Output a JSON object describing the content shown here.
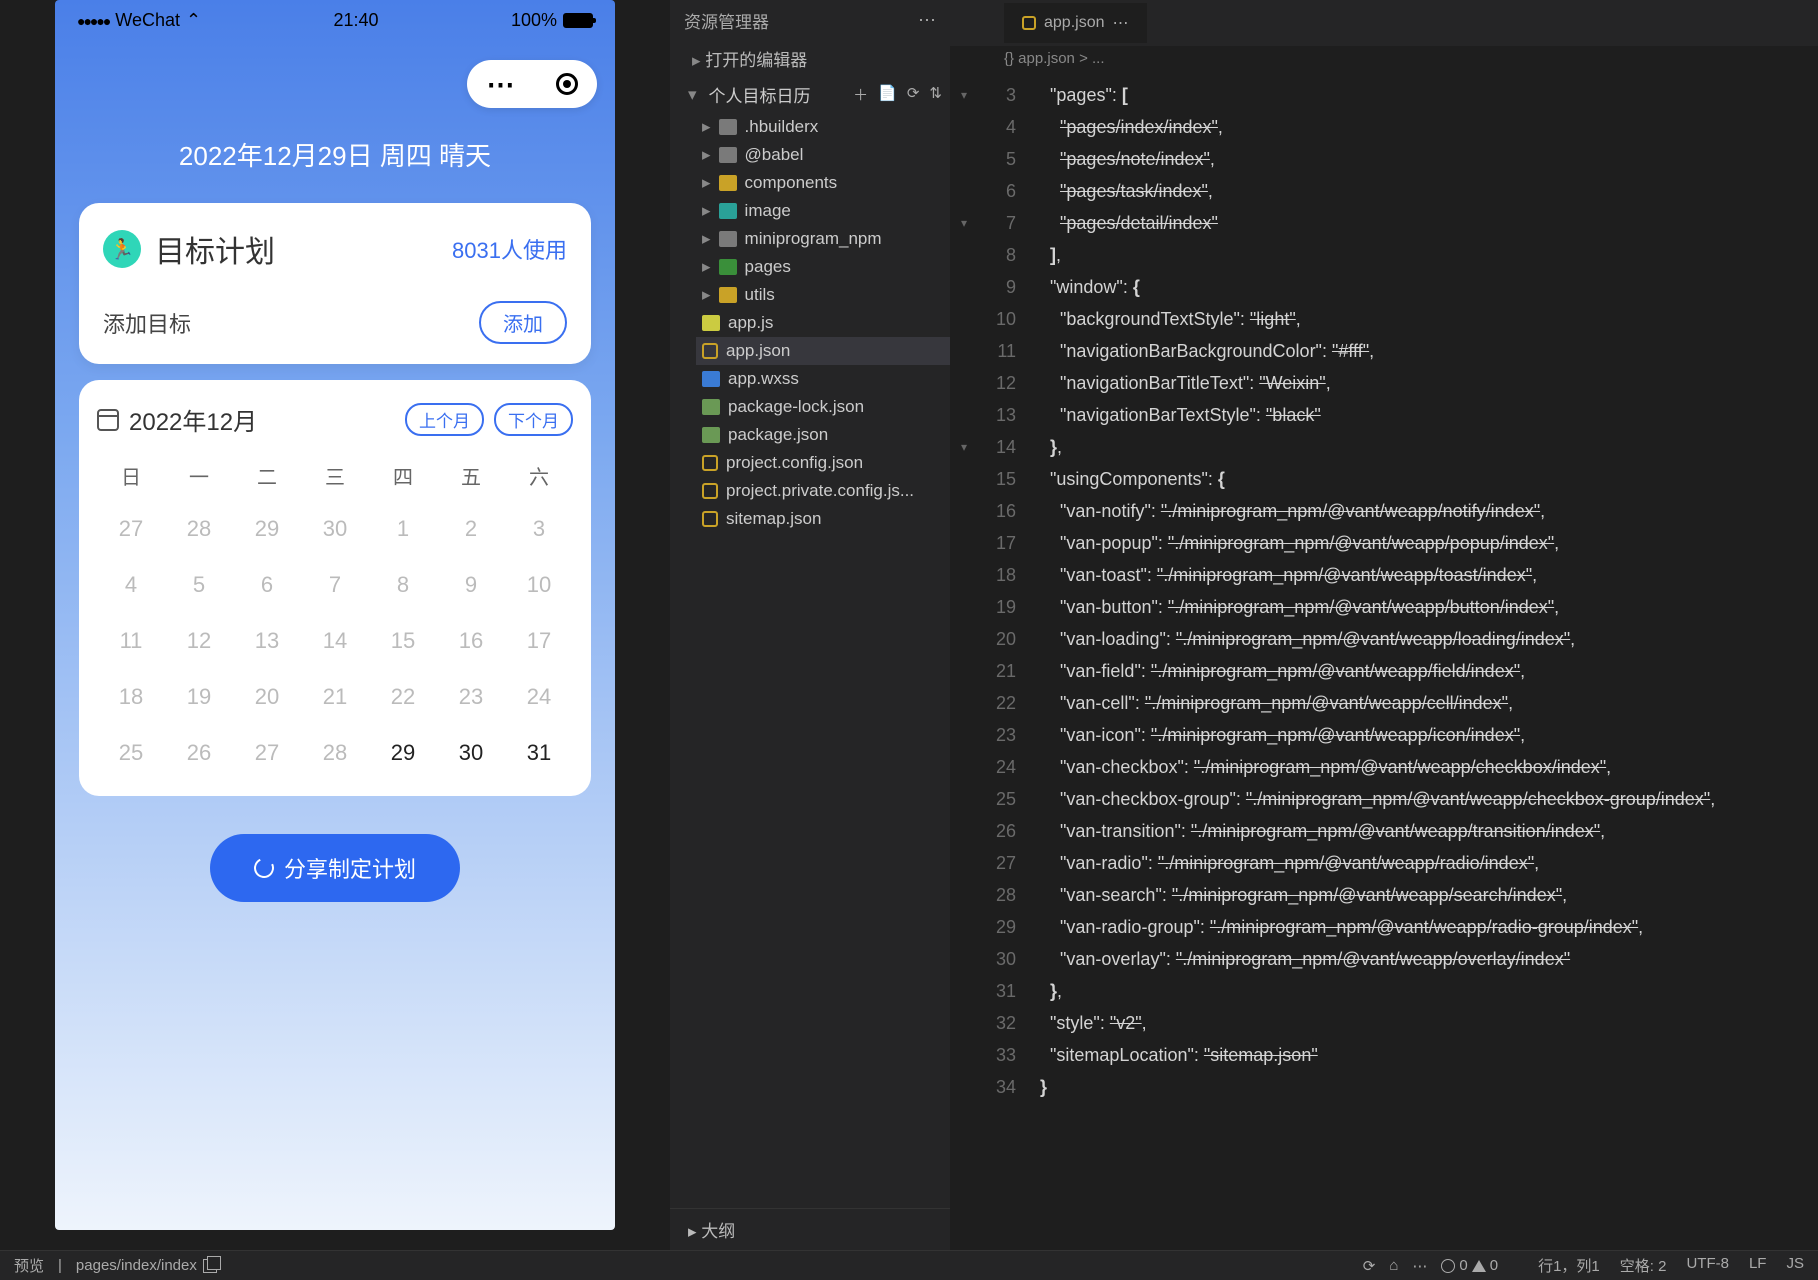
{
  "phone": {
    "statusbar": {
      "carrier": "WeChat",
      "signal": "●●●●●",
      "wifi": "⌃",
      "time": "21:40",
      "battery": "100%"
    },
    "dateHeader": "2022年12月29日 周四 晴天",
    "card": {
      "icon": "🏃",
      "title": "目标计划",
      "usage": "8031人使用",
      "addLabel": "添加目标",
      "addBtn": "添加"
    },
    "calendar": {
      "month": "2022年12月",
      "prevBtn": "上个月",
      "nextBtn": "下个月",
      "weekdays": [
        "日",
        "一",
        "二",
        "三",
        "四",
        "五",
        "六"
      ],
      "days": [
        {
          "n": "27"
        },
        {
          "n": "28"
        },
        {
          "n": "29"
        },
        {
          "n": "30"
        },
        {
          "n": "1"
        },
        {
          "n": "2"
        },
        {
          "n": "3"
        },
        {
          "n": "4"
        },
        {
          "n": "5"
        },
        {
          "n": "6"
        },
        {
          "n": "7"
        },
        {
          "n": "8"
        },
        {
          "n": "9"
        },
        {
          "n": "10"
        },
        {
          "n": "11"
        },
        {
          "n": "12"
        },
        {
          "n": "13"
        },
        {
          "n": "14"
        },
        {
          "n": "15"
        },
        {
          "n": "16"
        },
        {
          "n": "17"
        },
        {
          "n": "18"
        },
        {
          "n": "19"
        },
        {
          "n": "20"
        },
        {
          "n": "21"
        },
        {
          "n": "22"
        },
        {
          "n": "23"
        },
        {
          "n": "24"
        },
        {
          "n": "25"
        },
        {
          "n": "26"
        },
        {
          "n": "27"
        },
        {
          "n": "28"
        },
        {
          "n": "29",
          "cur": true
        },
        {
          "n": "30",
          "cur": true
        },
        {
          "n": "31",
          "cur": true
        }
      ]
    },
    "shareBtn": "分享制定计划"
  },
  "explorer": {
    "title": "资源管理器",
    "openEditors": "打开的编辑器",
    "rootName": "个人目标日历",
    "rootActions": [
      "＋",
      "📄",
      "⟳",
      "⇅"
    ],
    "items": [
      {
        "type": "folder",
        "icon": "fi-folder",
        "name": ".hbuilderx"
      },
      {
        "type": "folder",
        "icon": "fi-folder",
        "name": "@babel"
      },
      {
        "type": "folder",
        "icon": "fi-folder-y",
        "name": "components"
      },
      {
        "type": "folder",
        "icon": "fi-img",
        "name": "image"
      },
      {
        "type": "folder",
        "icon": "fi-folder",
        "name": "miniprogram_npm"
      },
      {
        "type": "folder",
        "icon": "fi-folder-g",
        "name": "pages"
      },
      {
        "type": "folder",
        "icon": "fi-folder-y",
        "name": "utils"
      },
      {
        "type": "file",
        "icon": "fi-js",
        "name": "app.js"
      },
      {
        "type": "file",
        "icon": "fi-json",
        "name": "app.json",
        "sel": true
      },
      {
        "type": "file",
        "icon": "fi-wxss",
        "name": "app.wxss"
      },
      {
        "type": "file",
        "icon": "fi-cfg",
        "name": "package-lock.json"
      },
      {
        "type": "file",
        "icon": "fi-cfg",
        "name": "package.json"
      },
      {
        "type": "file",
        "icon": "fi-json",
        "name": "project.config.json"
      },
      {
        "type": "file",
        "icon": "fi-json",
        "name": "project.private.config.js..."
      },
      {
        "type": "file",
        "icon": "fi-json",
        "name": "sitemap.json"
      }
    ],
    "outline": "大纲"
  },
  "editor": {
    "tab": "app.json",
    "breadcrumb": "{} app.json > ...",
    "startLine": 3,
    "foldMarks": {
      "3": "▾",
      "7": "▾",
      "14": "▾"
    },
    "lines": [
      {
        "t": "  <k>\"pages\"</k>: <b>[</b>"
      },
      {
        "t": "    <s>\"pages/index/index\"</s>,"
      },
      {
        "t": "    <s>\"pages/note/index\"</s>,"
      },
      {
        "t": "    <s>\"pages/task/index\"</s>,"
      },
      {
        "t": "    <s>\"pages/detail/index\"</s>"
      },
      {
        "t": "  <b>]</b>,"
      },
      {
        "t": "  <k>\"window\"</k>: <b>{</b>"
      },
      {
        "t": "    <k>\"backgroundTextStyle\"</k>: <s>\"light\"</s>,"
      },
      {
        "t": "    <k>\"navigationBarBackgroundColor\"</k>: <s>\"#fff\"</s>,"
      },
      {
        "t": "    <k>\"navigationBarTitleText\"</k>: <s>\"Weixin\"</s>,"
      },
      {
        "t": "    <k>\"navigationBarTextStyle\"</k>: <s>\"black\"</s>"
      },
      {
        "t": "  <b>}</b>,"
      },
      {
        "t": "  <k>\"usingComponents\"</k>: <b>{</b>"
      },
      {
        "t": "    <k>\"van-notify\"</k>: <s>\"./miniprogram_npm/@vant/weapp/notify/index\"</s>,"
      },
      {
        "t": "    <k>\"van-popup\"</k>: <s>\"./miniprogram_npm/@vant/weapp/popup/index\"</s>,"
      },
      {
        "t": "    <k>\"van-toast\"</k>: <s>\"./miniprogram_npm/@vant/weapp/toast/index\"</s>,"
      },
      {
        "t": "    <k>\"van-button\"</k>: <s>\"./miniprogram_npm/@vant/weapp/button/index\"</s>,"
      },
      {
        "t": "    <k>\"van-loading\"</k>: <s>\"./miniprogram_npm/@vant/weapp/loading/index\"</s>,"
      },
      {
        "t": "    <k>\"van-field\"</k>: <s>\"./miniprogram_npm/@vant/weapp/field/index\"</s>,"
      },
      {
        "t": "    <k>\"van-cell\"</k>: <s>\"./miniprogram_npm/@vant/weapp/cell/index\"</s>,"
      },
      {
        "t": "    <k>\"van-icon\"</k>: <s>\"./miniprogram_npm/@vant/weapp/icon/index\"</s>,"
      },
      {
        "t": "    <k>\"van-checkbox\"</k>: <s>\"./miniprogram_npm/@vant/weapp/checkbox/index\"</s>,"
      },
      {
        "t": "    <k>\"van-checkbox-group\"</k>: <s>\"./miniprogram_npm/@vant/weapp/checkbox-group/index\"</s>,"
      },
      {
        "t": "    <k>\"van-transition\"</k>: <s>\"./miniprogram_npm/@vant/weapp/transition/index\"</s>,"
      },
      {
        "t": "    <k>\"van-radio\"</k>: <s>\"./miniprogram_npm/@vant/weapp/radio/index\"</s>,"
      },
      {
        "t": "    <k>\"van-search\"</k>: <s>\"./miniprogram_npm/@vant/weapp/search/index\"</s>,"
      },
      {
        "t": "    <k>\"van-radio-group\"</k>: <s>\"./miniprogram_npm/@vant/weapp/radio-group/index\"</s>,"
      },
      {
        "t": "    <k>\"van-overlay\"</k>: <s>\"./miniprogram_npm/@vant/weapp/overlay/index\"</s>"
      },
      {
        "t": "  <b>}</b>,"
      },
      {
        "t": "  <k>\"style\"</k>: <s>\"v2\"</s>,"
      },
      {
        "t": "  <k>\"sitemapLocation\"</k>: <s>\"sitemap.json\"</s>"
      },
      {
        "t": "<b>}</b>"
      }
    ]
  },
  "statusbar": {
    "left": "预览",
    "breadcrumb": "pages/index/index",
    "errors": "0",
    "warnings": "0",
    "right": [
      "行1，列1",
      "空格: 2",
      "UTF-8",
      "LF",
      "JS"
    ]
  }
}
